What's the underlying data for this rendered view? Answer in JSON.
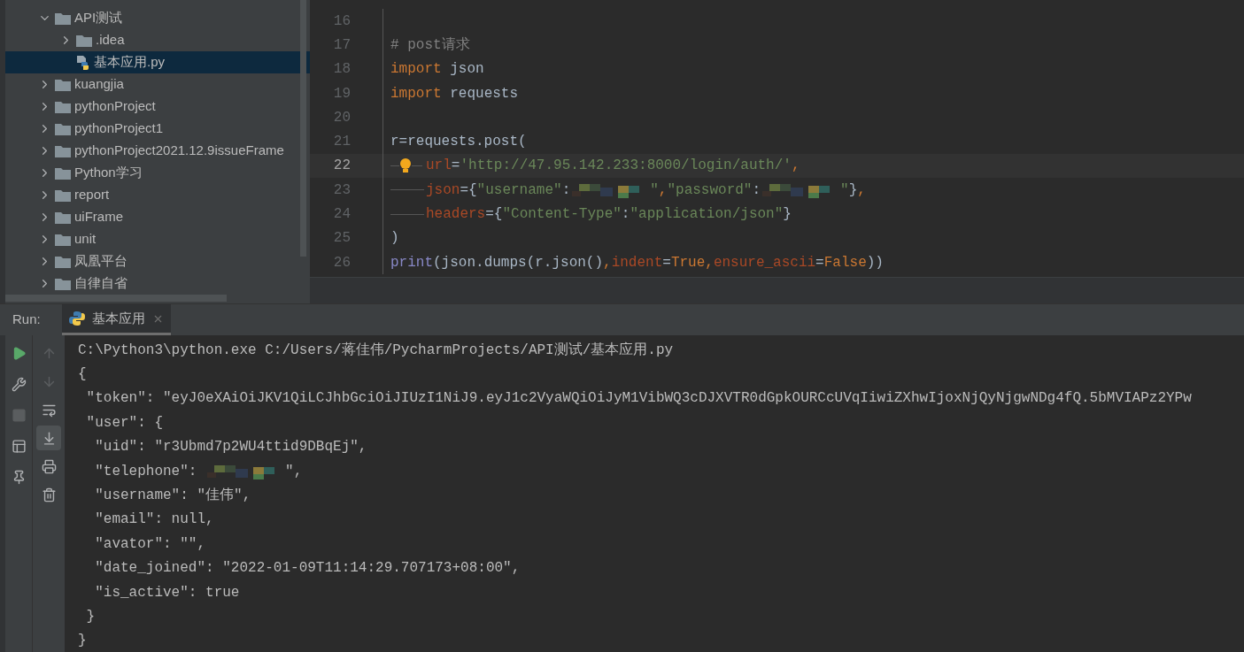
{
  "project_tree": {
    "items": [
      {
        "kind": "folder",
        "label": "API测试",
        "expanded": true,
        "selected": false,
        "children": [
          {
            "kind": "folder",
            "label": ".idea",
            "expanded": false,
            "selected": false
          },
          {
            "kind": "python-file",
            "label": "基本应用.py",
            "selected": true
          }
        ]
      },
      {
        "kind": "folder",
        "label": "kuangjia",
        "expanded": false,
        "selected": false
      },
      {
        "kind": "folder",
        "label": "pythonProject",
        "expanded": false,
        "selected": false
      },
      {
        "kind": "folder",
        "label": "pythonProject1",
        "expanded": false,
        "selected": false
      },
      {
        "kind": "folder",
        "label": "pythonProject2021.12.9issueFrame",
        "expanded": false,
        "selected": false
      },
      {
        "kind": "folder",
        "label": "Python学习",
        "expanded": false,
        "selected": false
      },
      {
        "kind": "folder",
        "label": "report",
        "expanded": false,
        "selected": false
      },
      {
        "kind": "folder",
        "label": "uiFrame",
        "expanded": false,
        "selected": false
      },
      {
        "kind": "folder",
        "label": "unit",
        "expanded": false,
        "selected": false
      },
      {
        "kind": "folder",
        "label": "凤凰平台",
        "expanded": false,
        "selected": false
      },
      {
        "kind": "folder",
        "label": "自律自省",
        "expanded": false,
        "selected": false
      }
    ]
  },
  "editor": {
    "lines": [
      {
        "number": "16",
        "current": false
      },
      {
        "number": "17",
        "current": false,
        "tokens": [
          {
            "kind": "comment",
            "text": "# post请求"
          }
        ]
      },
      {
        "number": "18",
        "current": false,
        "tokens": [
          {
            "kind": "keyword",
            "text": "import "
          },
          {
            "kind": "plain",
            "text": "json"
          }
        ]
      },
      {
        "number": "19",
        "current": false,
        "tokens": [
          {
            "kind": "keyword",
            "text": "import "
          },
          {
            "kind": "plain",
            "text": "requests"
          }
        ]
      },
      {
        "number": "20",
        "current": false
      },
      {
        "number": "21",
        "current": false,
        "tokens": [
          {
            "kind": "plain",
            "text": "r=requests.post("
          }
        ]
      },
      {
        "number": "22",
        "current": true,
        "bulb": true,
        "tokens": [
          {
            "kind": "indent"
          },
          {
            "kind": "param",
            "text": "url"
          },
          {
            "kind": "plain",
            "text": "="
          },
          {
            "kind": "string",
            "text": "'http://47.95.142.233:8000/login/auth/'"
          },
          {
            "kind": "keyword",
            "text": ","
          }
        ]
      },
      {
        "number": "23",
        "current": false,
        "bulb": false,
        "tokens": [
          {
            "kind": "indent"
          },
          {
            "kind": "param",
            "text": "json"
          },
          {
            "kind": "plain",
            "text": "={"
          },
          {
            "kind": "string",
            "text": "\"username\""
          },
          {
            "kind": "plain",
            "text": ":"
          },
          {
            "kind": "redacted"
          },
          {
            "kind": "string",
            "text": "\""
          },
          {
            "kind": "keyword",
            "text": ","
          },
          {
            "kind": "string",
            "text": "\"password\""
          },
          {
            "kind": "plain",
            "text": ":"
          },
          {
            "kind": "redacted"
          },
          {
            "kind": "string",
            "text": "\""
          },
          {
            "kind": "plain",
            "text": "}"
          },
          {
            "kind": "keyword",
            "text": ","
          }
        ]
      },
      {
        "number": "24",
        "current": false,
        "bulb": false,
        "tokens": [
          {
            "kind": "indent"
          },
          {
            "kind": "param",
            "text": "headers"
          },
          {
            "kind": "plain",
            "text": "={"
          },
          {
            "kind": "string",
            "text": "\"Content-Type\""
          },
          {
            "kind": "plain",
            "text": ":"
          },
          {
            "kind": "string",
            "text": "\"application/json\""
          },
          {
            "kind": "plain",
            "text": "}"
          }
        ]
      },
      {
        "number": "25",
        "current": false,
        "tokens": [
          {
            "kind": "plain",
            "text": ")"
          }
        ]
      },
      {
        "number": "26",
        "current": false,
        "tokens": [
          {
            "kind": "builtin",
            "text": "print"
          },
          {
            "kind": "plain",
            "text": "(json.dumps(r.json()"
          },
          {
            "kind": "keyword",
            "text": ","
          },
          {
            "kind": "param",
            "text": "indent"
          },
          {
            "kind": "plain",
            "text": "="
          },
          {
            "kind": "keyword",
            "text": "True"
          },
          {
            "kind": "keyword",
            "text": ","
          },
          {
            "kind": "param",
            "text": "ensure_ascii"
          },
          {
            "kind": "plain",
            "text": "="
          },
          {
            "kind": "keyword",
            "text": "False"
          },
          {
            "kind": "plain",
            "text": "))"
          }
        ]
      }
    ]
  },
  "run_panel": {
    "label": "Run:",
    "tabs": [
      {
        "label": "基本应用",
        "selected": true
      }
    ],
    "left_toolbar": [
      {
        "kind": "rerun",
        "disabled": false
      },
      {
        "kind": "settings",
        "disabled": false
      },
      {
        "kind": "stop",
        "disabled": true
      },
      {
        "kind": "layout",
        "disabled": false
      },
      {
        "kind": "pin",
        "disabled": false
      }
    ],
    "right_toolbar": [
      {
        "kind": "up",
        "disabled": true,
        "on": false
      },
      {
        "kind": "down",
        "disabled": true,
        "on": false
      },
      {
        "kind": "wrap",
        "disabled": false,
        "on": false
      },
      {
        "kind": "scroll-end",
        "disabled": false,
        "on": true
      },
      {
        "kind": "print",
        "disabled": false,
        "on": false
      },
      {
        "kind": "clear",
        "disabled": false,
        "on": false
      }
    ],
    "console": [
      [
        {
          "kind": "text",
          "text": "C:\\Python3\\python.exe C:/Users/蒋佳伟/PycharmProjects/API测试/基本应用.py"
        }
      ],
      [
        {
          "kind": "text",
          "text": "{"
        }
      ],
      [
        {
          "kind": "text",
          "text": " \"token\": \"eyJ0eXAiOiJKV1QiLCJhbGciOiJIUzI1NiJ9.eyJ1c2VyaWQiOiJyM1VibWQ3cDJXVTR0dGpkOURCcUVqIiwiZXhwIjoxNjQyNjgwNDg4fQ.5bMVIAPz2YPw"
        }
      ],
      [
        {
          "kind": "text",
          "text": " \"user\": {"
        }
      ],
      [
        {
          "kind": "text",
          "text": "  \"uid\": \"r3Ubmd7p2WU4ttid9DBqEj\","
        }
      ],
      [
        {
          "kind": "text",
          "text": "  \"telephone\": "
        },
        {
          "kind": "redacted"
        },
        {
          "kind": "text",
          "text": "\","
        }
      ],
      [
        {
          "kind": "text",
          "text": "  \"username\": \"佳伟\","
        }
      ],
      [
        {
          "kind": "text",
          "text": "  \"email\": null,"
        }
      ],
      [
        {
          "kind": "text",
          "text": "  \"avator\": \"\","
        }
      ],
      [
        {
          "kind": "text",
          "text": "  \"date_joined\": \"2022-01-09T11:14:29.707173+08:00\","
        }
      ],
      [
        {
          "kind": "text",
          "text": "  \"is_active\": true"
        }
      ],
      [
        {
          "kind": "text",
          "text": " }"
        }
      ],
      [
        {
          "kind": "text",
          "text": "}"
        }
      ]
    ]
  }
}
